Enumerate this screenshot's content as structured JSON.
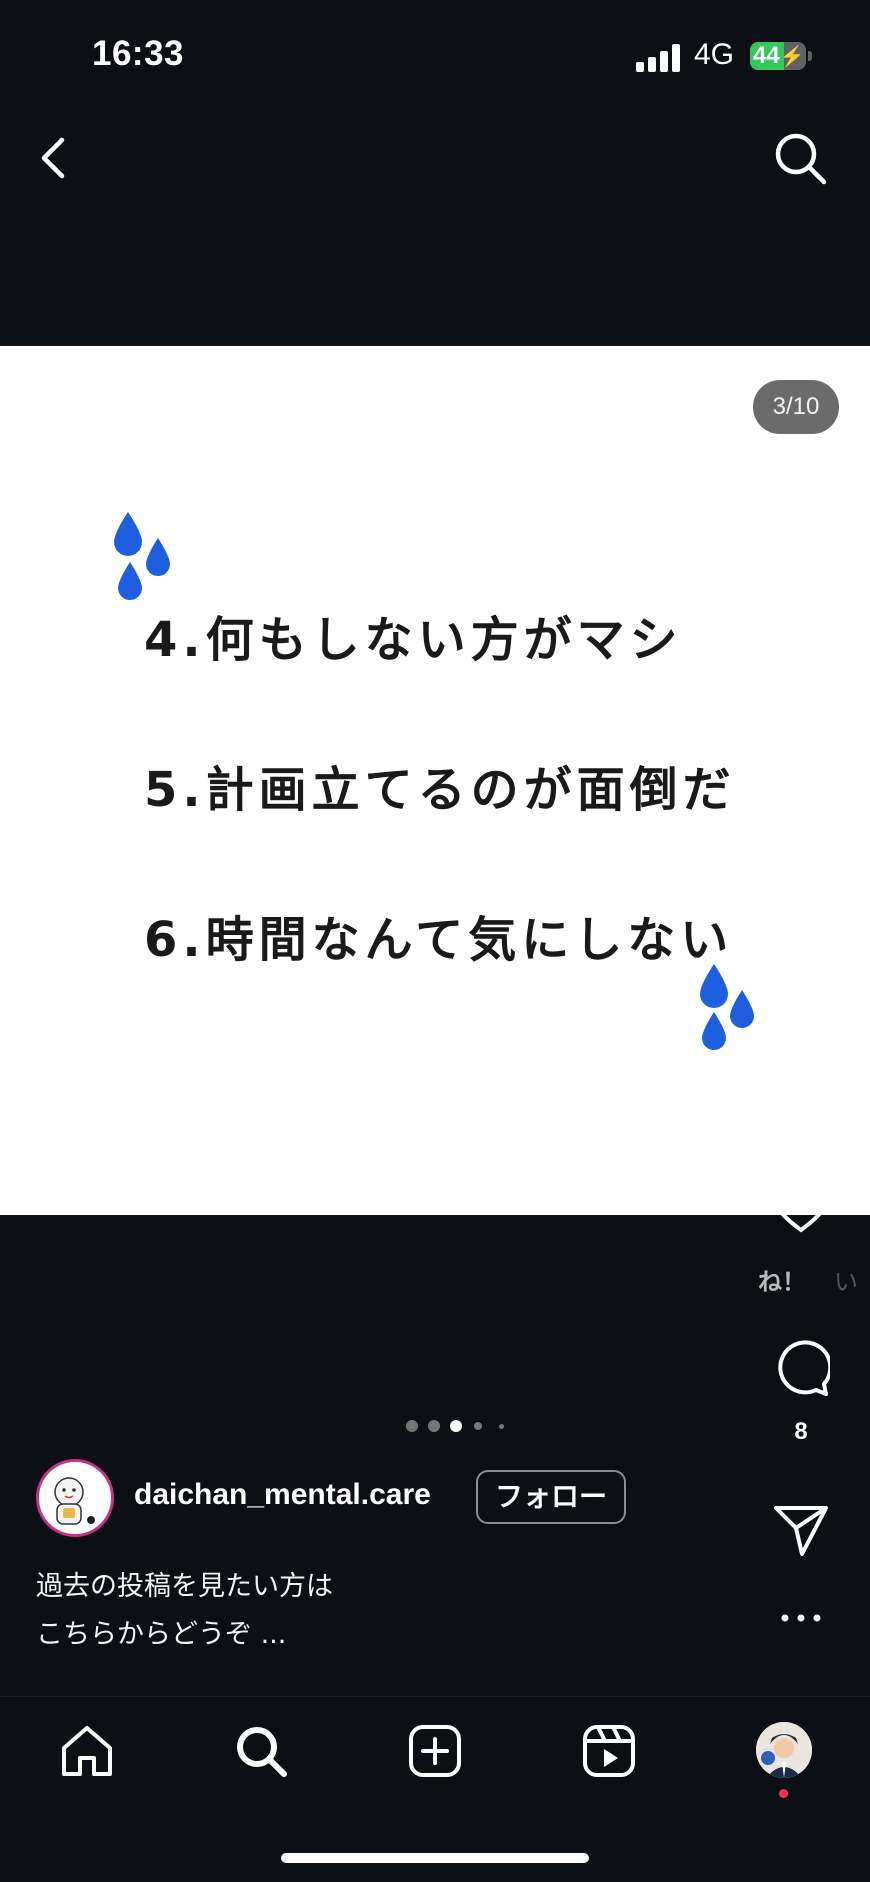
{
  "status_bar": {
    "time": "16:33",
    "network": "4G",
    "battery": "44"
  },
  "header": {
    "back_icon": "chevron-left-icon",
    "search_icon": "search-icon"
  },
  "post": {
    "counter": "3/10",
    "lines": [
      "4.何もしない方がマシ",
      "5.計画立てるのが面倒だ",
      "6.時間なんて気にしない"
    ],
    "drop_color": "#1e5fe0"
  },
  "actions": {
    "like_label": "ね！",
    "like_label_faded": "い",
    "comment_count": "8"
  },
  "carousel": {
    "total": 5,
    "active": 3
  },
  "user": {
    "username": "daichan_mental.care",
    "follow_label": "フォロー"
  },
  "caption": {
    "line1": "過去の投稿を見たい方は",
    "line2": "こちらからどうぞ ..."
  },
  "nav": [
    "home-icon",
    "search-icon",
    "create-icon",
    "reels-icon",
    "profile-avatar"
  ],
  "colors": {
    "background": "#0c0f14",
    "avatar_ring": "#c13584",
    "notification_dot": "#ff2d55"
  }
}
